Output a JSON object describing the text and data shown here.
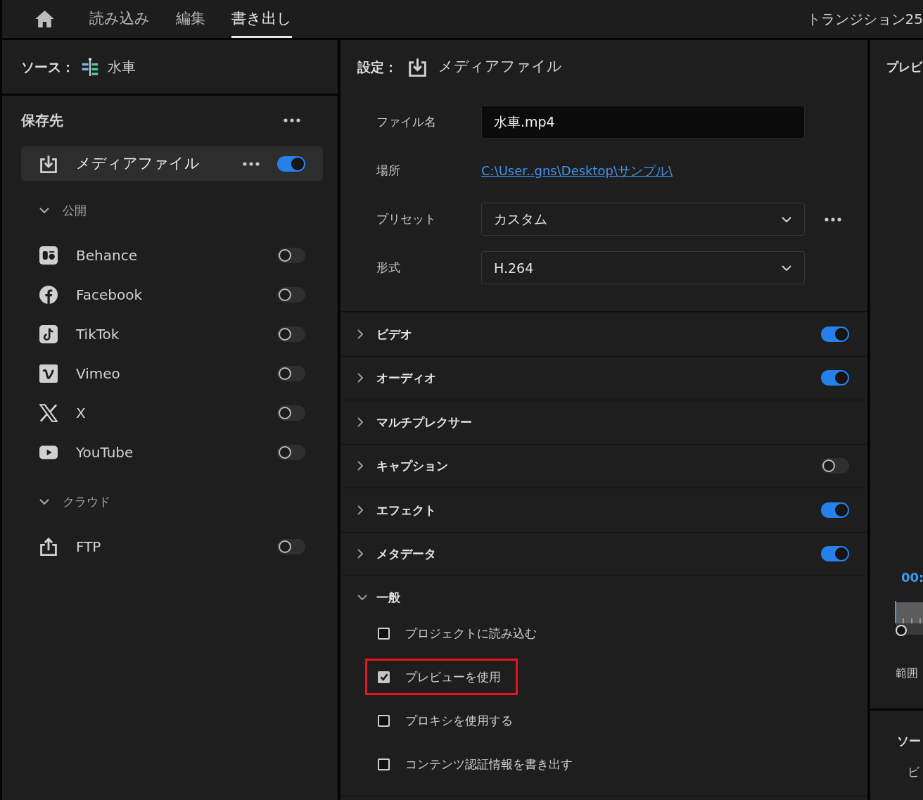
{
  "top_bar": {
    "tabs": [
      {
        "label": "読み込み",
        "selected": false
      },
      {
        "label": "編集",
        "selected": false
      },
      {
        "label": "書き出し",
        "selected": true
      }
    ],
    "project_title": "トランジション25"
  },
  "source": {
    "label": "ソース：",
    "name": "水車"
  },
  "destinations": {
    "title": "保存先",
    "items": [
      {
        "label": "メディアファイル",
        "selected": true,
        "on": true
      }
    ],
    "groups": [
      {
        "label": "公開",
        "expanded": true,
        "items": [
          {
            "label": "Behance",
            "selected": false,
            "on": false
          },
          {
            "label": "Facebook",
            "selected": false,
            "on": false
          },
          {
            "label": "TikTok",
            "selected": false,
            "on": false
          },
          {
            "label": "Vimeo",
            "selected": false,
            "on": false
          },
          {
            "label": "X",
            "selected": false,
            "on": false
          },
          {
            "label": "YouTube",
            "selected": false,
            "on": false
          }
        ]
      },
      {
        "label": "クラウド",
        "expanded": true,
        "items": [
          {
            "label": "FTP",
            "selected": false,
            "on": false
          }
        ]
      }
    ]
  },
  "settings": {
    "label": "設定：",
    "target": "メディアファイル",
    "fields": [
      {
        "kind": "text",
        "label": "ファイル名",
        "value": "水車.mp4"
      },
      {
        "kind": "link",
        "label": "場所",
        "value": "C:\\User..gns\\Desktop\\サンプル\\"
      },
      {
        "kind": "dropdown",
        "label": "プリセット",
        "value": "カスタム",
        "more": true
      },
      {
        "kind": "dropdown",
        "label": "形式",
        "value": "H.264"
      }
    ],
    "sections": [
      {
        "label": "ビデオ",
        "expanded": false,
        "on": true
      },
      {
        "label": "オーディオ",
        "expanded": false,
        "on": true
      },
      {
        "label": "マルチプレクサー",
        "expanded": false
      },
      {
        "label": "キャプション",
        "expanded": false,
        "on": false
      },
      {
        "label": "エフェクト",
        "expanded": false,
        "on": true
      },
      {
        "label": "メタデータ",
        "expanded": false,
        "on": true
      },
      {
        "label": "一般",
        "expanded": true,
        "options": [
          {
            "label": "プロジェクトに読み込む",
            "checked": false,
            "highlighted": false
          },
          {
            "label": "プレビューを使用",
            "checked": true,
            "highlighted": true
          },
          {
            "label": "プロキシを使用する",
            "checked": false,
            "highlighted": false
          },
          {
            "label": "コンテンツ認証情報を書き出す",
            "checked": false,
            "highlighted": false
          }
        ]
      }
    ]
  },
  "preview": {
    "title": "プレビ",
    "timecode": "00:",
    "range_label": "範囲",
    "source_title": "ソー",
    "source_line": "ビ"
  }
}
